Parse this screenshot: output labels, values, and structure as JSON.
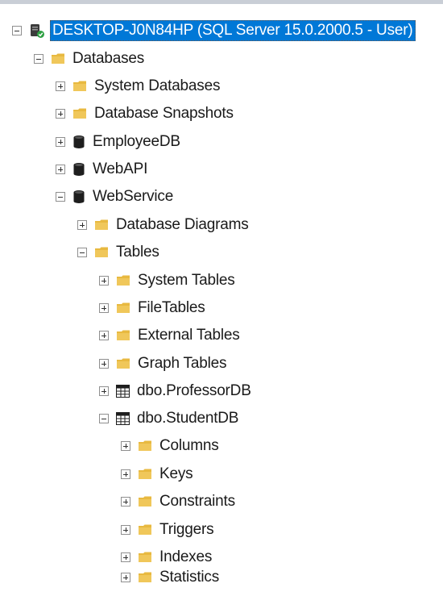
{
  "tree": {
    "server": {
      "label": "DESKTOP-J0N84HP (SQL Server 15.0.2000.5 - User)",
      "icon": "server-connected-icon",
      "state": "expanded",
      "selected": true
    },
    "databases": {
      "label": "Databases",
      "icon": "folder-icon",
      "state": "expanded"
    },
    "system_databases": {
      "label": "System Databases",
      "icon": "folder-icon",
      "state": "collapsed"
    },
    "database_snapshots": {
      "label": "Database Snapshots",
      "icon": "folder-icon",
      "state": "collapsed"
    },
    "employeedb": {
      "label": "EmployeeDB",
      "icon": "database-icon",
      "state": "collapsed"
    },
    "webapi": {
      "label": "WebAPI",
      "icon": "database-icon",
      "state": "collapsed"
    },
    "webservice": {
      "label": "WebService",
      "icon": "database-icon",
      "state": "expanded"
    },
    "database_diagrams": {
      "label": "Database Diagrams",
      "icon": "folder-icon",
      "state": "collapsed"
    },
    "tables": {
      "label": "Tables",
      "icon": "folder-icon",
      "state": "expanded"
    },
    "system_tables": {
      "label": "System Tables",
      "icon": "folder-icon",
      "state": "collapsed"
    },
    "filetables": {
      "label": "FileTables",
      "icon": "folder-icon",
      "state": "collapsed"
    },
    "external_tables": {
      "label": "External Tables",
      "icon": "folder-icon",
      "state": "collapsed"
    },
    "graph_tables": {
      "label": "Graph Tables",
      "icon": "folder-icon",
      "state": "collapsed"
    },
    "dbo_professordb": {
      "label": "dbo.ProfessorDB",
      "icon": "table-icon",
      "state": "collapsed"
    },
    "dbo_studentdb": {
      "label": "dbo.StudentDB",
      "icon": "table-icon",
      "state": "expanded"
    },
    "columns": {
      "label": "Columns",
      "icon": "folder-icon",
      "state": "collapsed"
    },
    "keys": {
      "label": "Keys",
      "icon": "folder-icon",
      "state": "collapsed"
    },
    "constraints": {
      "label": "Constraints",
      "icon": "folder-icon",
      "state": "collapsed"
    },
    "triggers": {
      "label": "Triggers",
      "icon": "folder-icon",
      "state": "collapsed"
    },
    "indexes": {
      "label": "Indexes",
      "icon": "folder-icon",
      "state": "collapsed"
    },
    "statistics": {
      "label": "Statistics",
      "icon": "folder-icon",
      "state": "collapsed"
    }
  },
  "colors": {
    "selection": "#0078d7",
    "folder": "#e8b940",
    "database": "#1e1e1e"
  }
}
